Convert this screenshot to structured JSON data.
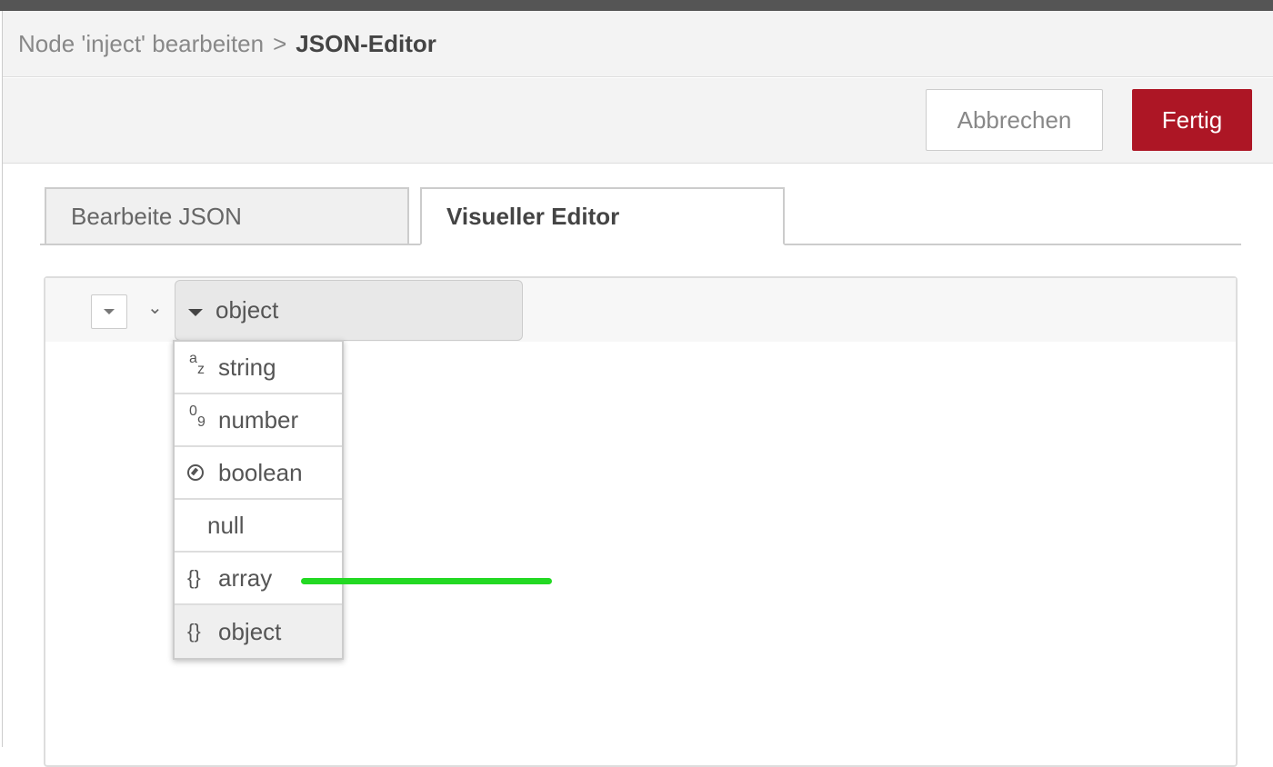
{
  "breadcrumb": {
    "parent": "Node 'inject' bearbeiten",
    "separator": ">",
    "current": "JSON-Editor"
  },
  "toolbar": {
    "cancel_label": "Abbrechen",
    "done_label": "Fertig"
  },
  "tabs": [
    {
      "label": "Bearbeite JSON",
      "active": false
    },
    {
      "label": "Visueller Editor",
      "active": true
    }
  ],
  "editor": {
    "root_type": "object",
    "type_menu": [
      {
        "icon": "az-icon",
        "label": "string"
      },
      {
        "icon": "09-icon",
        "label": "number"
      },
      {
        "icon": "boolean-icon",
        "label": "boolean"
      },
      {
        "icon": "",
        "label": "null"
      },
      {
        "icon": "braces-icon",
        "label": "array"
      },
      {
        "icon": "braces-icon",
        "label": "object",
        "selected": true
      }
    ]
  },
  "colors": {
    "primary_button": "#ad1625",
    "highlight_marker": "#23d923"
  }
}
